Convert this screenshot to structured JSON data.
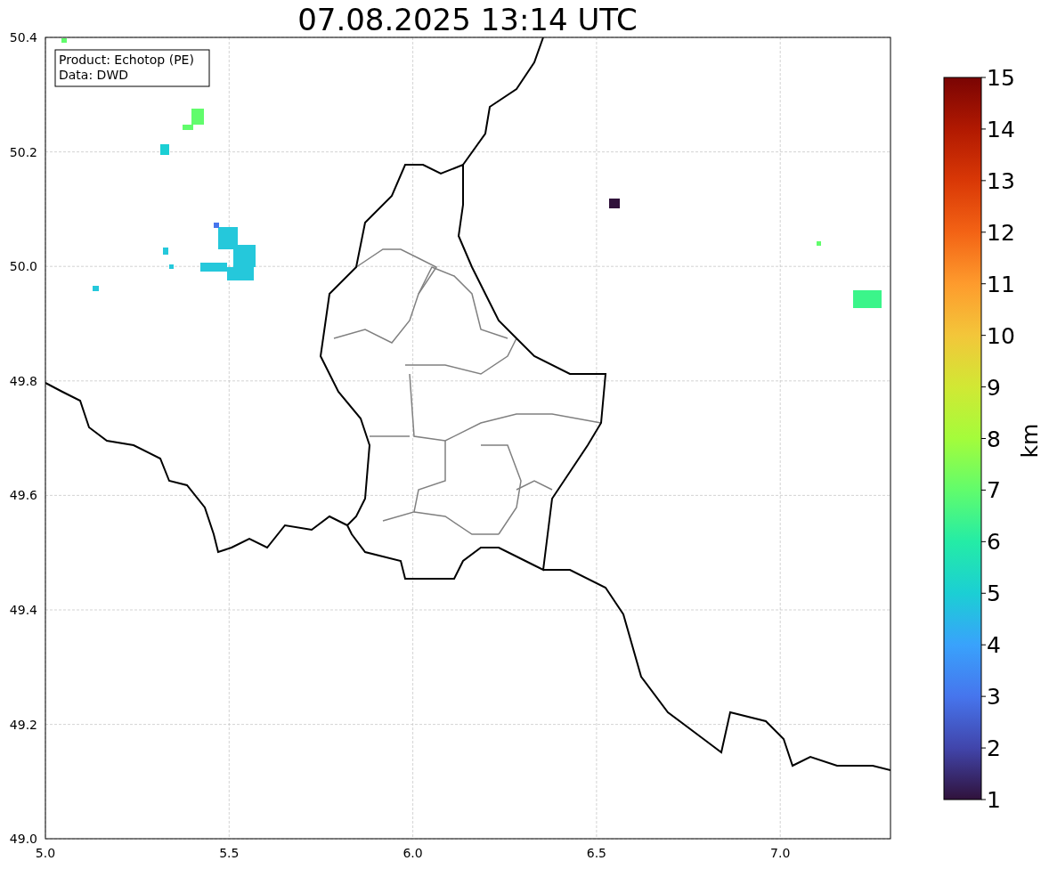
{
  "title": "07.08.2025 13:14 UTC",
  "info_box": [
    "Product: Echotop (PE)",
    "Data: DWD"
  ],
  "x_ticks": [
    "5.0",
    "5.5",
    "6.0",
    "6.5",
    "7.0"
  ],
  "y_ticks": [
    "50.4",
    "50.2",
    "50.0",
    "49.8",
    "49.6",
    "49.4",
    "49.2",
    "49.0"
  ],
  "colorbar": {
    "label": "km",
    "ticks": [
      "15",
      "14",
      "13",
      "12",
      "11",
      "10",
      "9",
      "8",
      "7",
      "6",
      "5",
      "4",
      "3",
      "2",
      "1"
    ]
  }
}
